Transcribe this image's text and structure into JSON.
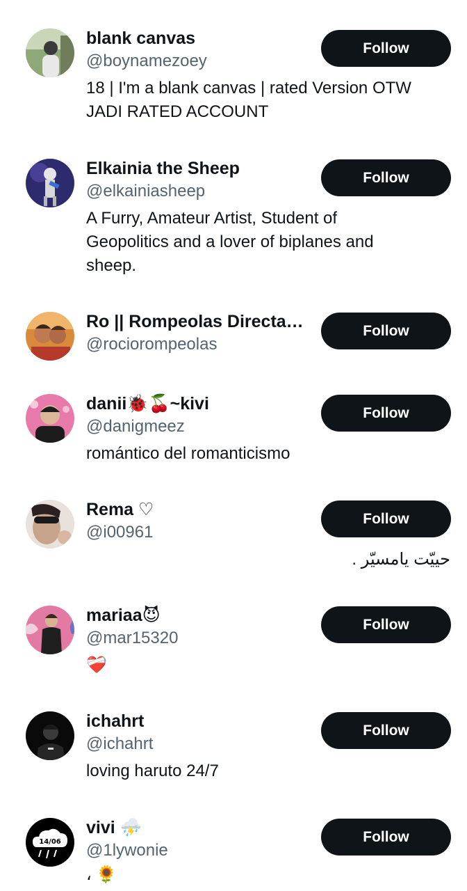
{
  "follow_label": "Follow",
  "accounts": [
    {
      "name": "blank canvas",
      "handle": "@boynamezoey",
      "bio": "18 | I'm a blank canvas | rated Version OTW JADI RATED ACCOUNT",
      "avatar": "person-outdoors-avatar"
    },
    {
      "name": "Elkainia the Sheep",
      "handle": "@elkainiasheep",
      "bio": "A Furry, Amateur Artist, Student of Geopolitics and a lover of biplanes and sheep.",
      "avatar": "sheep-character-avatar"
    },
    {
      "name": "Ro || Rompeolas Directas…",
      "handle": "@rociorompeolas",
      "bio": "",
      "avatar": "couple-photo-avatar"
    },
    {
      "name": "danii🐞🍒~kivi",
      "handle": "@danigmeez",
      "bio": "romántico del romanticismo",
      "avatar": "person-pink-background-avatar"
    },
    {
      "name": "Rema ♡",
      "handle": "@i00961",
      "bio": "حييّت يامسيّر .",
      "avatar": "face-closeup-avatar"
    },
    {
      "name": "mariaa😈",
      "handle": "@mar15320",
      "bio": "❤️‍🩹",
      "avatar": "figure-pink-background-avatar"
    },
    {
      "name": "ichahrt",
      "handle": "@ichahrt",
      "bio": "loving haruto 24/7",
      "avatar": "dark-portrait-avatar"
    },
    {
      "name": "vivi ⛈️",
      "handle": "@1lywonie",
      "bio": "، 🌻",
      "avatar": "cloud-logo-avatar",
      "avatar_text": "14/06"
    }
  ],
  "colors": {
    "button_bg": "#0f1419",
    "handle_text": "#536471"
  }
}
